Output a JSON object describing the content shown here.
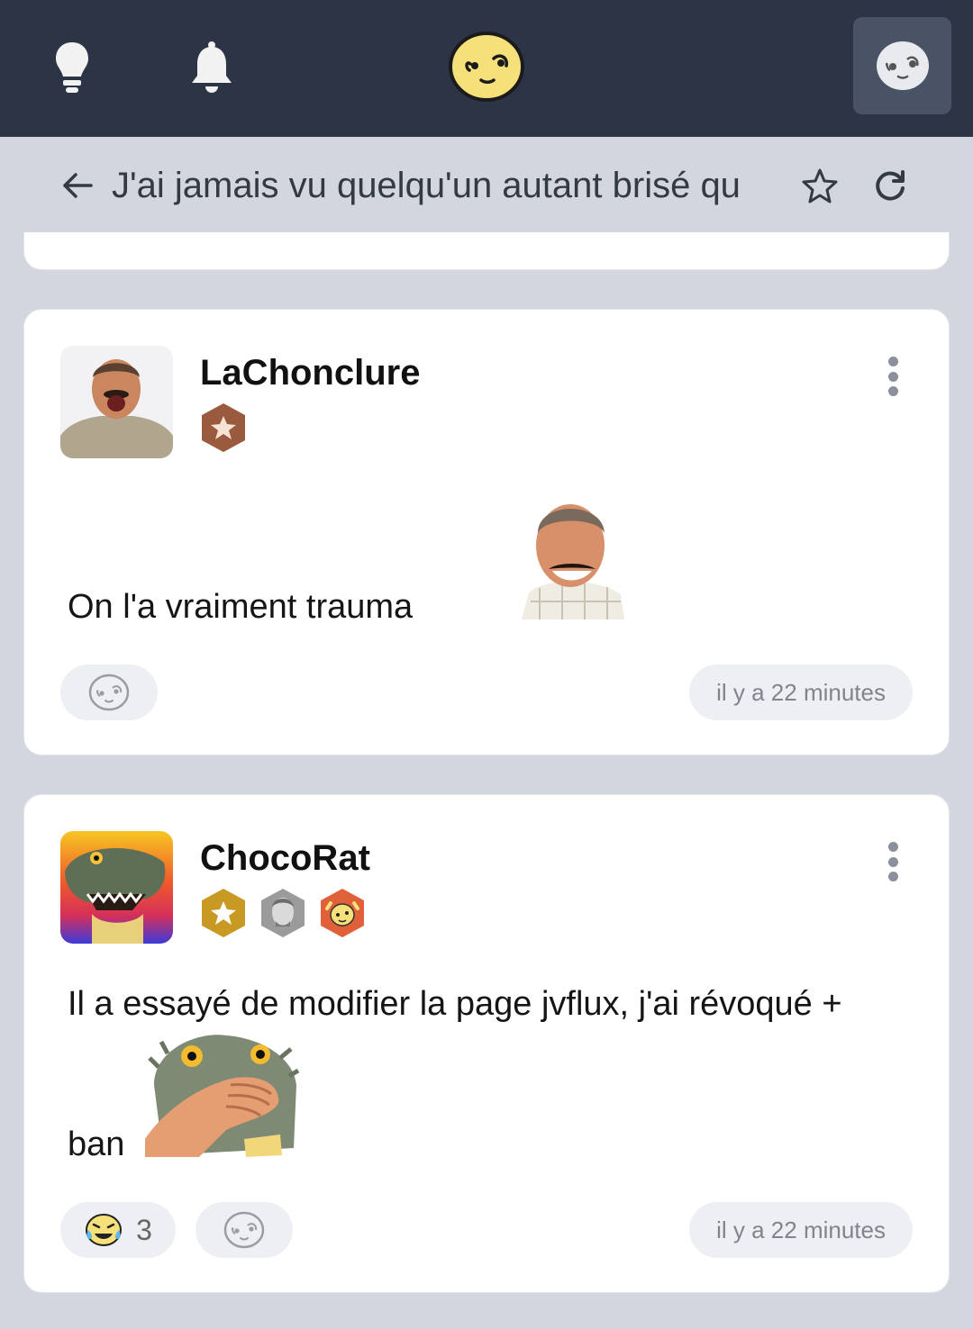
{
  "topbar": {
    "icons": [
      "lightbulb-icon",
      "bell-icon",
      "logo-smiley-icon",
      "profile-smiley-icon"
    ]
  },
  "header": {
    "title": "J'ai jamais vu quelqu'un autant brisé qu",
    "icons": [
      "arrow-left-icon",
      "star-icon",
      "refresh-icon"
    ]
  },
  "posts": [
    {
      "username": "LaChonclure",
      "badges": [
        "bronze-star-badge"
      ],
      "text": "On l'a vraiment trauma",
      "sticker": "laughing-man-sticker",
      "reactions": [],
      "time": "il y a 22 minutes"
    },
    {
      "username": "ChocoRat",
      "badges": [
        "gold-star-badge",
        "gray-face-badge",
        "orange-smiley-badge"
      ],
      "text_line1": "Il a essayé de modifier la page jvflux, j'ai révoqué +",
      "text_line2": "ban",
      "sticker": "lizard-hand-sticker",
      "reactions": [
        {
          "emoji": "tears-of-joy-icon",
          "count": "3"
        }
      ],
      "time": "il y a 22 minutes"
    }
  ],
  "colors": {
    "topbar": "#2d3446",
    "background": "#d3d6df",
    "card": "#ffffff",
    "pill": "#eeeff2",
    "logo_yellow": "#f6e07a"
  }
}
